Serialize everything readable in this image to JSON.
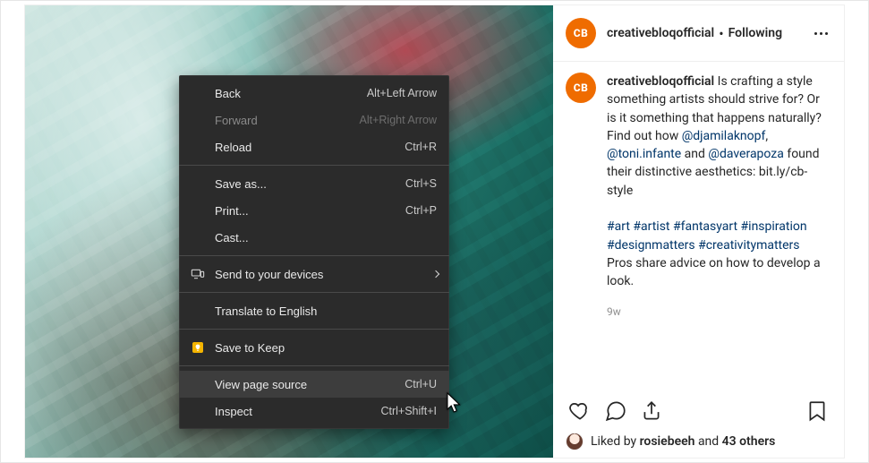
{
  "colors": {
    "brand": "#ef6c00",
    "link": "#003569"
  },
  "header": {
    "avatar_text": "CB",
    "username": "creativebloqofficial",
    "separator": "•",
    "follow_state": "Following"
  },
  "caption": {
    "avatar_text": "CB",
    "username": "creativebloqofficial",
    "text_1": " Is crafting a style something artists should strive for? Or is it something that happens naturally? Find out how ",
    "mention_1": "@djamilaknopf",
    "sep_1": ", ",
    "mention_2": "@toni.infante",
    "sep_2": " and ",
    "mention_3": "@daverapoza",
    "text_2": " found their distinctive aesthetics: bit.ly/cb-style",
    "hashtags": [
      "#art",
      "#artist",
      "#fantasyart",
      "#inspiration",
      "#designmatters",
      "#creativitymatters"
    ],
    "text_3": "Pros share advice on how to develop a look.",
    "timestamp": "9w"
  },
  "likes": {
    "prefix": "Liked by ",
    "liker": "rosiebeeh",
    "mid": " and ",
    "others": "43 others"
  },
  "context_menu": {
    "items": [
      {
        "id": "back",
        "label": "Back",
        "accel": "Alt+Left Arrow",
        "disabled": false
      },
      {
        "id": "forward",
        "label": "Forward",
        "accel": "Alt+Right Arrow",
        "disabled": true
      },
      {
        "id": "reload",
        "label": "Reload",
        "accel": "Ctrl+R"
      },
      {
        "sep": true
      },
      {
        "id": "save-as",
        "label": "Save as...",
        "accel": "Ctrl+S"
      },
      {
        "id": "print",
        "label": "Print...",
        "accel": "Ctrl+P"
      },
      {
        "id": "cast",
        "label": "Cast..."
      },
      {
        "sep": true
      },
      {
        "id": "send-devices",
        "label": "Send to your devices",
        "submenu": true,
        "icon": "devices"
      },
      {
        "sep": true
      },
      {
        "id": "translate",
        "label": "Translate to English"
      },
      {
        "sep": true
      },
      {
        "id": "keep",
        "label": "Save to Keep",
        "icon": "keep"
      },
      {
        "sep": true
      },
      {
        "id": "view-source",
        "label": "View page source",
        "accel": "Ctrl+U",
        "hover": true
      },
      {
        "id": "inspect",
        "label": "Inspect",
        "accel": "Ctrl+Shift+I"
      }
    ]
  }
}
